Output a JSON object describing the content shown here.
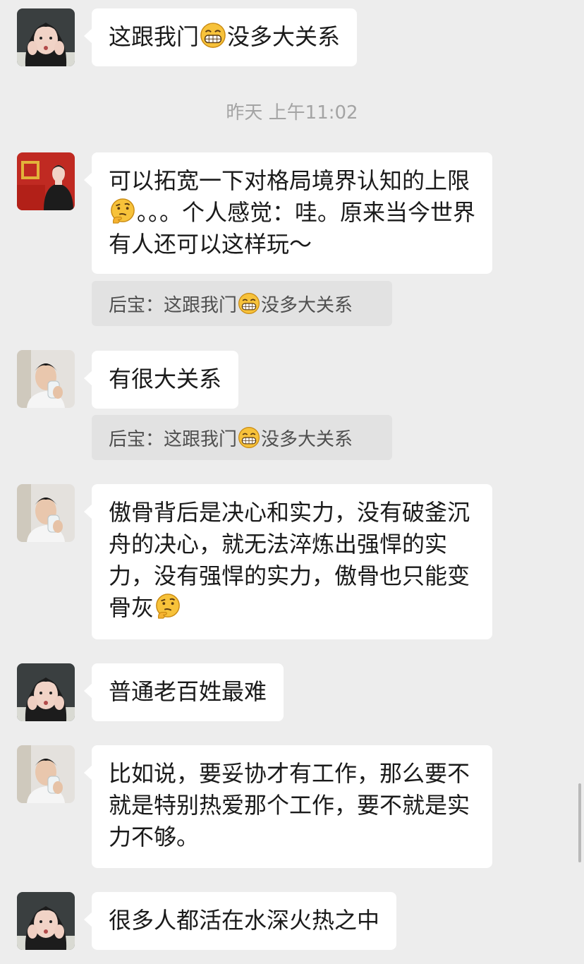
{
  "timestamp": "昨天 上午11:02",
  "messages": [
    {
      "sender": "woman",
      "emoji": "grin-emoji",
      "text_a": "这跟我门",
      "text_b": "没多大关系"
    },
    {
      "sender": "red-background",
      "emoji": "thinking-emoji",
      "text_a": "可以拓宽一下对格局境界认知的上限",
      "text_b": "。。。个人感觉：哇。原来当今世界有人还可以这样玩～"
    },
    {
      "sender": "man",
      "text": "有很大关系"
    },
    {
      "sender": "man",
      "emoji": "thinking-emoji",
      "text_a": "傲骨背后是决心和实力，没有破釜沉舟的决心，就无法淬炼出强悍的实力，没有强悍的实力，傲骨也只能变骨灰",
      "text_b": ""
    },
    {
      "sender": "woman",
      "text": "普通老百姓最难"
    },
    {
      "sender": "man",
      "text": "比如说，要妥协才有工作，那么要不就是特别热爱那个工作，要不就是实力不够。"
    },
    {
      "sender": "woman",
      "text": "很多人都活在水深火热之中"
    }
  ],
  "quotes": [
    {
      "text_a": "后宝：这跟我门",
      "emoji": "grin-emoji",
      "text_b": "没多大关系"
    },
    {
      "text_a": "后宝：这跟我门",
      "emoji": "grin-emoji",
      "text_b": "没多大关系"
    }
  ],
  "colors": {
    "background": "#ededed",
    "bubble": "#ffffff",
    "quote": "#e2e2e2",
    "emoji": "#f7c23a"
  }
}
